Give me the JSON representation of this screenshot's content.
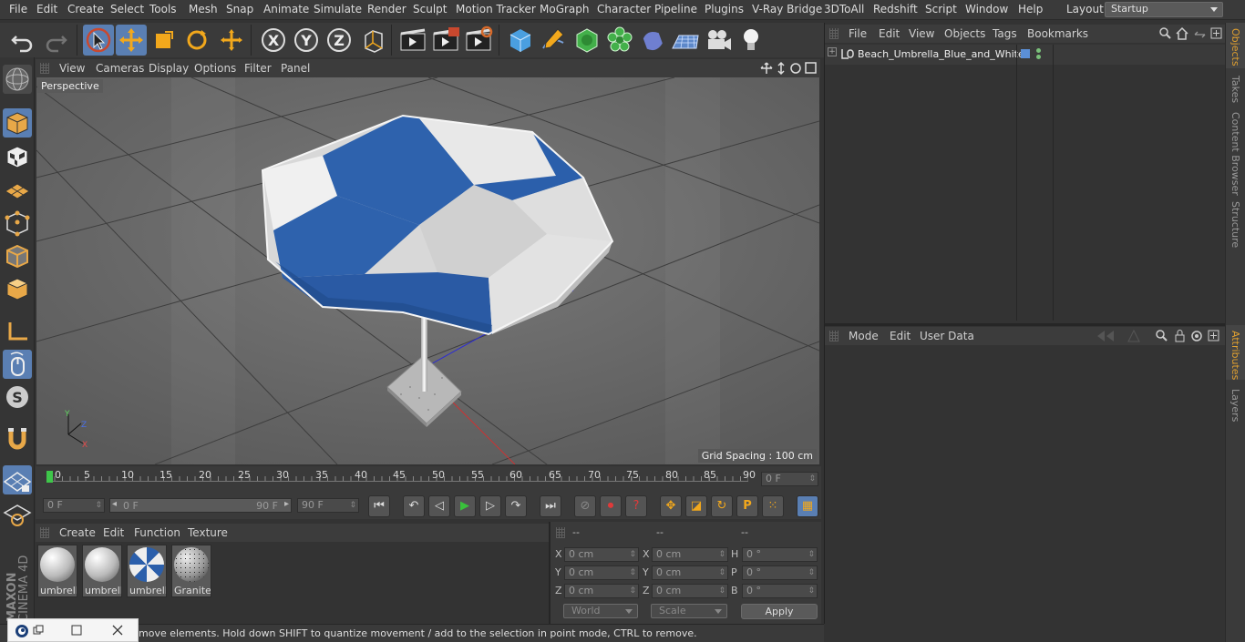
{
  "menubar": {
    "items": [
      "File",
      "Edit",
      "Create",
      "Select",
      "Tools",
      "Mesh",
      "Snap",
      "Animate",
      "Simulate",
      "Render",
      "Sculpt",
      "Motion Tracker",
      "MoGraph",
      "Character",
      "Pipeline",
      "Plugins",
      "V-Ray Bridge",
      "3DToAll",
      "Redshift",
      "Script",
      "Window",
      "Help"
    ],
    "layout_label": "Layout:",
    "layout_value": "Startup"
  },
  "viewport": {
    "menu": [
      "View",
      "Cameras",
      "Display",
      "Options",
      "Filter",
      "Panel"
    ],
    "camera_label": "Perspective",
    "grid_spacing": "Grid Spacing : 100 cm"
  },
  "objects_panel": {
    "menu": [
      "File",
      "Edit",
      "View",
      "Objects",
      "Tags",
      "Bookmarks"
    ],
    "object_name": "Beach_Umbrella_Blue_and_White",
    "layer_color": "#5b8fd6"
  },
  "attributes_panel": {
    "menu": [
      "Mode",
      "Edit",
      "User Data"
    ]
  },
  "side_tabs": {
    "top": [
      "Objects",
      "Takes",
      "Content Browser",
      "Structure"
    ],
    "bottom": [
      "Attributes",
      "Layers"
    ]
  },
  "timeline": {
    "ticks": [
      "0",
      "5",
      "10",
      "15",
      "20",
      "25",
      "30",
      "35",
      "40",
      "45",
      "50",
      "55",
      "60",
      "65",
      "70",
      "75",
      "80",
      "85",
      "90"
    ],
    "current_frame": "0 F",
    "start_field": "0 F",
    "range_start": "0 F",
    "range_end": "90 F",
    "end_field": "90 F"
  },
  "material_panel": {
    "menu": [
      "Create",
      "Edit",
      "Function",
      "Texture"
    ],
    "materials": [
      {
        "name": "umbrella",
        "kind": "white"
      },
      {
        "name": "umbrella",
        "kind": "white"
      },
      {
        "name": "umbrella",
        "kind": "bluewhite"
      },
      {
        "name": "Granite_",
        "kind": "granite"
      }
    ]
  },
  "coords_panel": {
    "headers": [
      "--",
      "--",
      "--"
    ],
    "rows": [
      {
        "a": "X",
        "av": "0 cm",
        "b": "X",
        "bv": "0 cm",
        "c": "H",
        "cv": "0 °"
      },
      {
        "a": "Y",
        "av": "0 cm",
        "b": "Y",
        "bv": "0 cm",
        "c": "P",
        "cv": "0 °"
      },
      {
        "a": "Z",
        "av": "0 cm",
        "b": "Z",
        "bv": "0 cm",
        "c": "B",
        "cv": "0 °"
      }
    ],
    "space": "World",
    "mode": "Scale",
    "apply": "Apply"
  },
  "brand": {
    "line1": "MAXON",
    "line2": "CINEMA 4D"
  },
  "status": "move elements. Hold down SHIFT to quantize movement / add to the selection in point mode, CTRL to remove.",
  "axes": {
    "x": "X",
    "y": "Y",
    "z": "Z"
  },
  "colors": {
    "accent": "#4f8fd8",
    "active": "#5a7fb3",
    "play": "#39c13b"
  }
}
